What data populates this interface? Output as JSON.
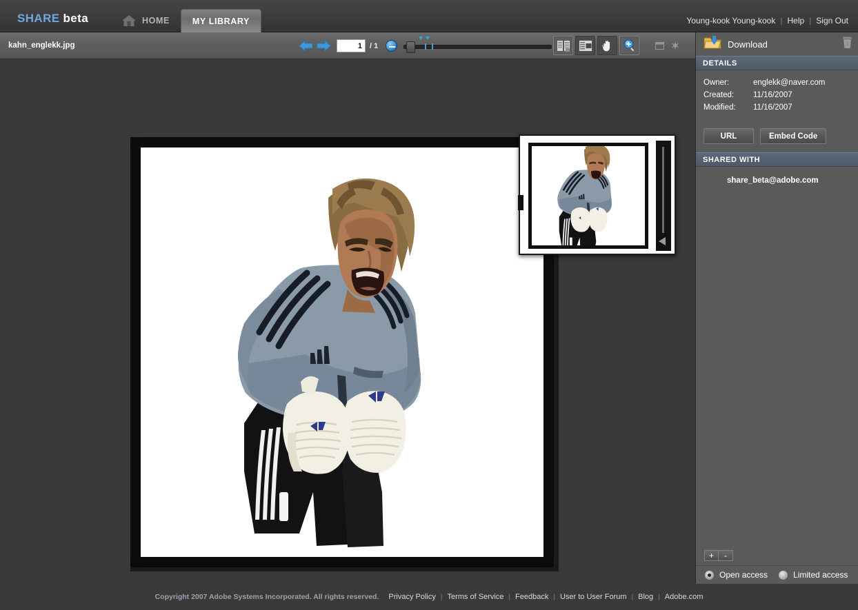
{
  "header": {
    "logo_share": "SHARE",
    "logo_beta": "beta",
    "nav": [
      {
        "label": "HOME",
        "icon": "home-icon",
        "active": false
      },
      {
        "label": "MY LIBRARY",
        "icon": "",
        "active": true
      }
    ],
    "user_name": "Young-kook Young-kook",
    "help_label": "Help",
    "signout_label": "Sign Out",
    "separator": "|"
  },
  "toolbar": {
    "filename": "kahn_englekk.jpg",
    "prev_icon": "arrow-left-icon",
    "next_icon": "arrow-right-icon",
    "page_value": "1",
    "page_total": "/ 1",
    "zoom_out_icon": "zoom-out-icon",
    "zoom_in_icon": "zoom-in-icon",
    "tools": [
      {
        "name": "page-layout-icon",
        "selected": false
      },
      {
        "name": "single-page-icon",
        "selected": false
      },
      {
        "name": "hand-tool-icon",
        "selected": false
      },
      {
        "name": "zoom-tool-icon",
        "selected": true
      }
    ],
    "window_buttons": [
      {
        "name": "restore-window-icon"
      },
      {
        "name": "close-window-icon"
      }
    ]
  },
  "panel": {
    "download_label": "Download",
    "download_icon": "download-folder-icon",
    "delete_icon": "trash-icon",
    "details_title": "DETAILS",
    "details": [
      {
        "key": "Owner:",
        "value": "englekk@naver.com"
      },
      {
        "key": "Created:",
        "value": "11/16/2007"
      },
      {
        "key": "Modified:",
        "value": "11/16/2007"
      }
    ],
    "url_button": "URL",
    "embed_button": "Embed Code",
    "shared_title": "SHARED WITH",
    "shared_with": [
      "share_beta@adobe.com"
    ],
    "add_button": "+",
    "remove_button": "-",
    "access_options": [
      {
        "label": "Open access",
        "selected": true
      },
      {
        "label": "Limited access",
        "selected": false
      }
    ]
  },
  "footer": {
    "copyright": "Copyright 2007 Adobe Systems Incorporated. All rights reserved.",
    "links": [
      "Privacy Policy",
      "Terms of Service",
      "Feedback",
      "User to User Forum",
      "Blog",
      "Adobe.com"
    ],
    "separator": "|"
  },
  "colors": {
    "accent_blue": "#6fa8dc",
    "topbar_bg": "#3c3c3c",
    "toolbar_bg": "#5e5e5e",
    "viewer_bg": "#3a3a3a",
    "panel_bg": "#5a5a5a",
    "section_header_bg": "#4e5a68",
    "footer_text": "#9aa3ad"
  },
  "document": {
    "alt": "Illustration of a goalkeeper in a grey adidas jersey shouting, black shorts, white goalkeeper gloves, framed by a grunge black border"
  }
}
